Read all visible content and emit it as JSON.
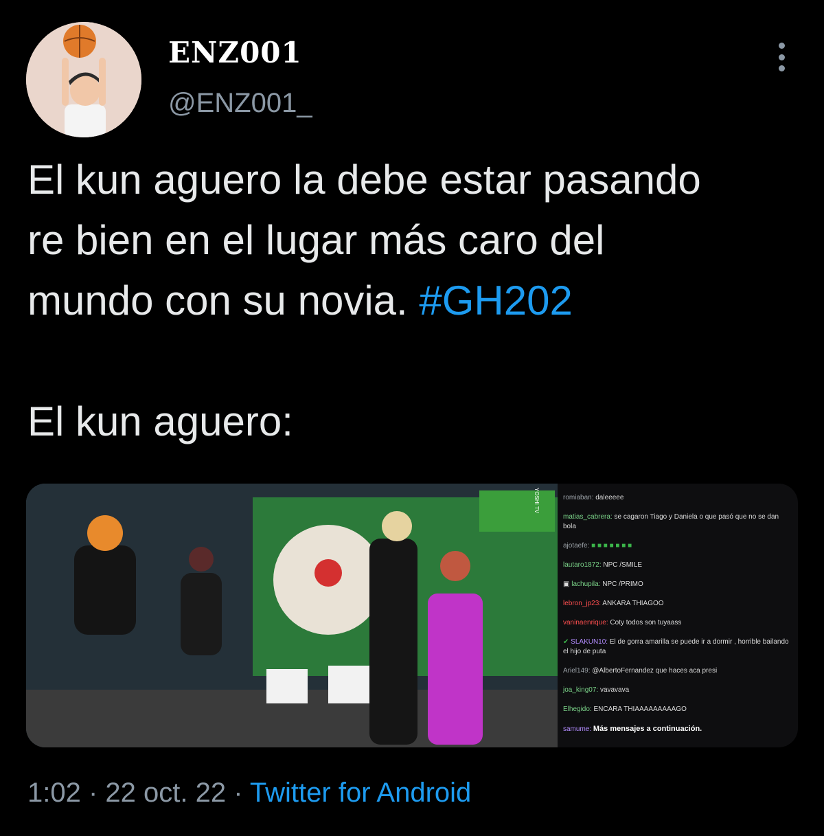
{
  "author": {
    "display_name": "ENZ001",
    "handle": "@ENZ001_"
  },
  "tweet": {
    "text_line1": "El kun aguero la debe estar pasando",
    "text_line2": "re bien en el lugar más caro del",
    "text_line3_prefix": "mundo con su novia. ",
    "hashtag": "#GH202",
    "text_line4": "El kun aguero:"
  },
  "media": {
    "watermark": "YOSHI TV",
    "chat": [
      {
        "user": "romiaban:",
        "message": "daleeeee"
      },
      {
        "user": "matias_cabrera:",
        "message": "se cagaron Tiago y Daniela o que pasó que no se dan bola"
      },
      {
        "user": "ajotaefe:",
        "message": ""
      },
      {
        "user": "lautaro1872:",
        "message": "NPC /SMILE"
      },
      {
        "user": "lachupila:",
        "message": "NPC /PRIMO"
      },
      {
        "user": "lebron_jp23:",
        "message": "ANKARA THIAGOO"
      },
      {
        "user": "vaninaenrique:",
        "message": "Coty todos son tuyaass"
      },
      {
        "user": "SLAKUN10:",
        "message": "El de gorra amarilla se puede ir a dormir , horrible bailando el hijo de puta"
      },
      {
        "user": "Ariel149:",
        "message": "@AlbertoFernandez que haces aca presi"
      },
      {
        "user": "joa_king07:",
        "message": "vavavava"
      },
      {
        "user": "Elhegido:",
        "message": "ENCARA THIAAAAAAAAAGO"
      }
    ],
    "more_messages": "Más mensajes a continuación.",
    "last_user": "samume:"
  },
  "footer": {
    "time": "1:02",
    "sep1": " · ",
    "date": "22 oct. 22",
    "sep2": " · ",
    "source": "Twitter for Android"
  },
  "colors": {
    "background": "#000000",
    "text": "#e7e9ea",
    "muted": "#8b98a5",
    "accent": "#1d9bf0"
  }
}
